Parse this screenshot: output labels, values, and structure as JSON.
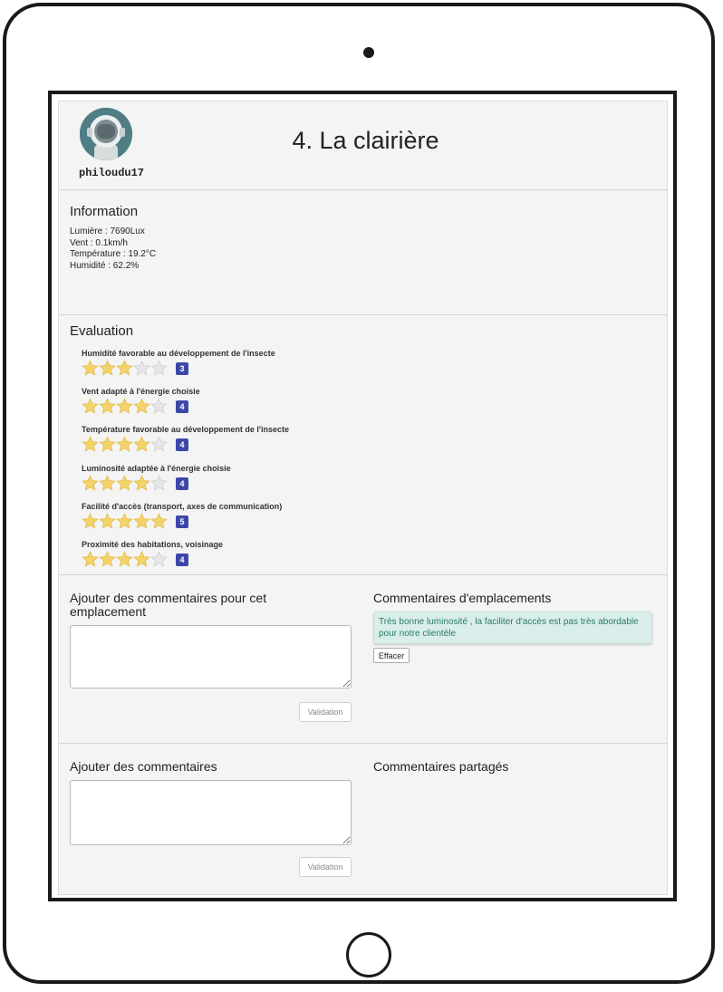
{
  "header": {
    "username": "philoudu17",
    "title": "4. La clairière"
  },
  "information": {
    "title": "Information",
    "lines": [
      "Lumière : 7690Lux",
      "Vent : 0.1km/h",
      "Température : 19.2°C",
      "Humidité : 62.2%"
    ]
  },
  "evaluation": {
    "title": "Evaluation",
    "max_stars": 5,
    "star_color": "#f4d36b",
    "empty_star_color": "#e6e6e6",
    "badge_color": "#3d47a8",
    "criteria": [
      {
        "label": "Humidité favorable au développement de l'insecte",
        "rating": 3,
        "badge": "3"
      },
      {
        "label": "Vent adapté à l'énergie choisie",
        "rating": 4,
        "badge": "4"
      },
      {
        "label": "Température favorable au développement de l'insecte",
        "rating": 4,
        "badge": "4"
      },
      {
        "label": "Luminosité adaptée à l'énergie choisie",
        "rating": 4,
        "badge": "4"
      },
      {
        "label": "Facilité d'accès (transport, axes de communication)",
        "rating": 5,
        "badge": "5"
      },
      {
        "label": "Proximité des habitations, voisinage",
        "rating": 4,
        "badge": "4"
      }
    ]
  },
  "location_comments": {
    "add_title": "Ajouter des commentaires pour cet emplacement",
    "textarea_value": "",
    "submit_label": "Validation",
    "list_title": "Commentaires d'emplacements",
    "comments": [
      "Très bonne luminosité , la faciliter d'accès est pas très abordable pour notre clientèle"
    ],
    "delete_label": "Effacer"
  },
  "shared_comments": {
    "add_title": "Ajouter des commentaires",
    "textarea_value": "",
    "submit_label": "Validation",
    "list_title": "Commentaires partagés"
  }
}
